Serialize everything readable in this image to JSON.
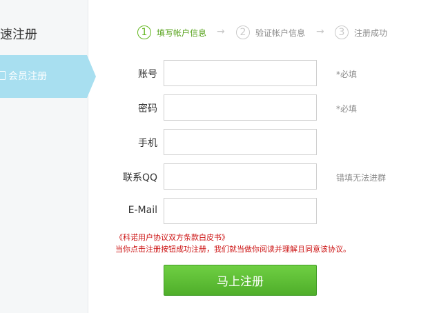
{
  "sidebar": {
    "title": "速注册",
    "item_label": "会员注册"
  },
  "steps": [
    {
      "num": "1",
      "label": "填写帐户信息"
    },
    {
      "num": "2",
      "label": "验证帐户信息"
    },
    {
      "num": "3",
      "label": "注册成功"
    }
  ],
  "arrow_glyph": "→",
  "form": {
    "account": {
      "label": "账号",
      "value": "",
      "hint": "*必填"
    },
    "password": {
      "label": "密码",
      "value": "",
      "hint": "*必填"
    },
    "phone": {
      "label": "手机",
      "value": ""
    },
    "qq": {
      "label": "联系QQ",
      "value": "",
      "hint": "错填无法进群"
    },
    "email": {
      "label": "E-Mail",
      "value": ""
    }
  },
  "agreement": {
    "link_text": "《科诺用户协议双方条款白皮书》",
    "note": "当你点击注册按钮成功注册，我们就当做你阅读并理解且同意该协议。"
  },
  "submit_label": "马上注册",
  "colors": {
    "accent_green": "#62b61e",
    "sidebar_active": "#a8dff0",
    "warning_red": "#cc1212"
  }
}
